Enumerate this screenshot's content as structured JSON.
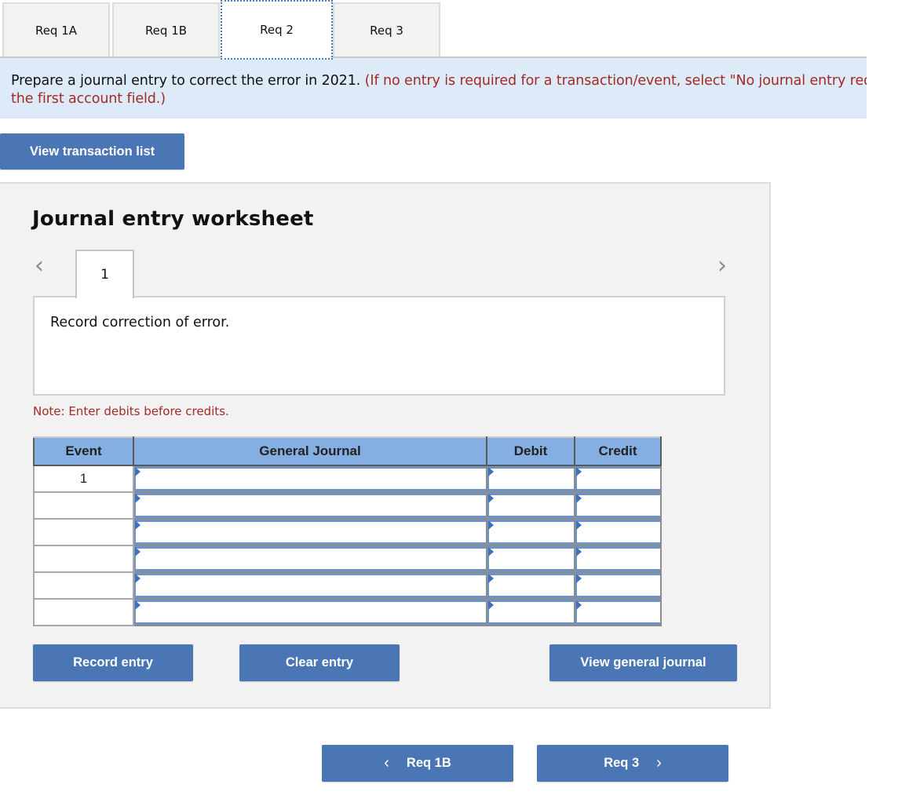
{
  "tabs": [
    {
      "label": "Req 1A",
      "active": false
    },
    {
      "label": "Req 1B",
      "active": false
    },
    {
      "label": "Req 2",
      "active": true
    },
    {
      "label": "Req 3",
      "active": false
    }
  ],
  "instructions": {
    "main": "Prepare a journal entry to correct the error in 2021. ",
    "hint_line1": "(If no entry is required for a transaction/event, select \"No journal entry required\" in",
    "hint_line2": "the first account field.)"
  },
  "view_transaction_list_label": "View transaction list",
  "worksheet": {
    "title": "Journal entry worksheet",
    "prev_icon": "chevron-left-icon",
    "next_icon": "chevron-right-icon",
    "prev_glyph": "‹",
    "next_glyph": "›",
    "entry_tabs": [
      "1"
    ],
    "description": "Record correction of error.",
    "note": "Note: Enter debits before credits.",
    "table": {
      "headers": [
        "Event",
        "General Journal",
        "Debit",
        "Credit"
      ],
      "rows": [
        {
          "event": "1",
          "account": "",
          "debit": "",
          "credit": ""
        },
        {
          "event": "",
          "account": "",
          "debit": "",
          "credit": ""
        },
        {
          "event": "",
          "account": "",
          "debit": "",
          "credit": ""
        },
        {
          "event": "",
          "account": "",
          "debit": "",
          "credit": ""
        },
        {
          "event": "",
          "account": "",
          "debit": "",
          "credit": ""
        },
        {
          "event": "",
          "account": "",
          "debit": "",
          "credit": ""
        }
      ]
    },
    "buttons": {
      "record": "Record entry",
      "clear": "Clear entry",
      "view_general_journal": "View general journal"
    }
  },
  "bottom_nav": {
    "prev_label": "Req 1B",
    "next_label": "Req 3",
    "prev_glyph": "‹",
    "next_glyph": "›"
  },
  "colors": {
    "accent_button": "#4a76b5",
    "banner_bg": "#ddeaf7",
    "hint_red": "#a42a25",
    "table_header": "#85aee2",
    "panel_bg": "#f2f2f2"
  }
}
